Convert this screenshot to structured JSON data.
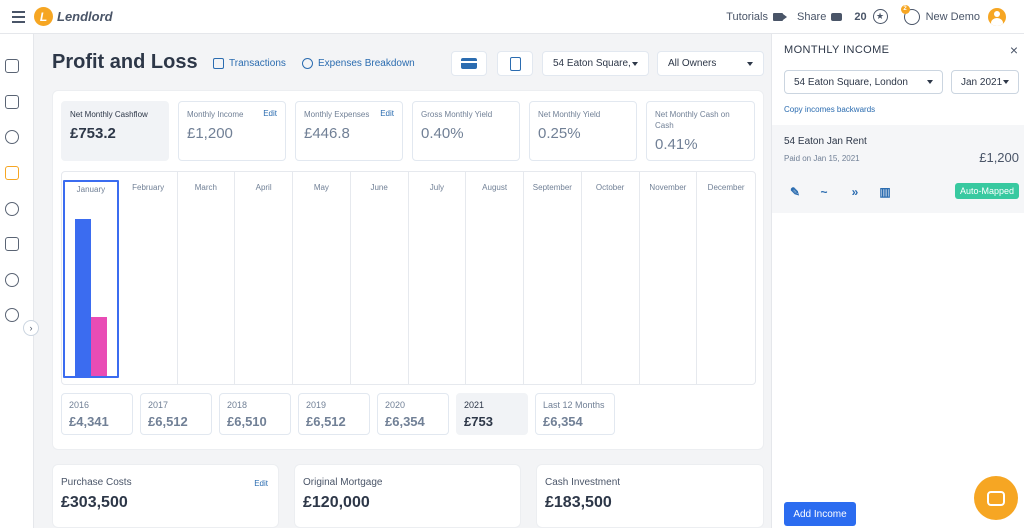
{
  "topbar": {
    "brand": "Lendlord",
    "tutorials": "Tutorials",
    "share": "Share",
    "count": "20",
    "notif_count": "2",
    "user": "New Demo"
  },
  "page": {
    "title": "Profit and Loss",
    "transactions": "Transactions",
    "expenses_breakdown": "Expenses Breakdown",
    "property_select": "54 Eaton Square,",
    "owners_select": "All Owners"
  },
  "metrics": [
    {
      "label": "Net Monthly Cashflow",
      "value": "£753.2",
      "edit": ""
    },
    {
      "label": "Monthly Income",
      "value": "£1,200",
      "edit": "Edit"
    },
    {
      "label": "Monthly Expenses",
      "value": "£446.8",
      "edit": "Edit"
    },
    {
      "label": "Gross Monthly Yield",
      "value": "0.40%",
      "edit": ""
    },
    {
      "label": "Net Monthly Yield",
      "value": "0.25%",
      "edit": ""
    },
    {
      "label": "Net Monthly Cash on Cash",
      "value": "0.41%",
      "edit": ""
    }
  ],
  "chart_data": {
    "type": "bar",
    "categories": [
      "January",
      "February",
      "March",
      "April",
      "May",
      "June",
      "July",
      "August",
      "September",
      "October",
      "November",
      "December"
    ],
    "series": [
      {
        "values": [
          1200,
          0,
          0,
          0,
          0,
          0,
          0,
          0,
          0,
          0,
          0,
          0
        ],
        "color": "#3b6cf0"
      },
      {
        "values": [
          446.8,
          0,
          0,
          0,
          0,
          0,
          0,
          0,
          0,
          0,
          0,
          0
        ],
        "color": "#e94cb5"
      }
    ],
    "ylim": [
      0,
      1450
    ],
    "selected_category": "January",
    "xlabel": "",
    "ylabel": ""
  },
  "years": [
    {
      "label": "2016",
      "value": "£4,341"
    },
    {
      "label": "2017",
      "value": "£6,512"
    },
    {
      "label": "2018",
      "value": "£6,510"
    },
    {
      "label": "2019",
      "value": "£6,512"
    },
    {
      "label": "2020",
      "value": "£6,354"
    },
    {
      "label": "2021",
      "value": "£753"
    },
    {
      "label": "Last 12 Months",
      "value": "£6,354"
    }
  ],
  "bottom": {
    "purchase_label": "Purchase Costs",
    "purchase_value": "£303,500",
    "purchase_edit": "Edit",
    "mortgage_label": "Original Mortgage",
    "mortgage_value": "£120,000",
    "cash_label": "Cash Investment",
    "cash_value": "£183,500"
  },
  "drawer": {
    "title": "MONTHLY INCOME",
    "close": "×",
    "property": "54 Eaton Square, London",
    "month": "Jan 2021",
    "copy_link": "Copy incomes backwards",
    "item_name": "54 Eaton Jan Rent",
    "item_date": "Paid on Jan 15, 2021",
    "item_amount": "£1,200",
    "badge": "Auto-Mapped",
    "add_button": "Add Income"
  },
  "colors": {
    "accent": "#2b6cb0",
    "brand": "#f6a623",
    "income_bar": "#3b6cf0",
    "expense_bar": "#e94cb5",
    "badge": "#38c9a0"
  }
}
